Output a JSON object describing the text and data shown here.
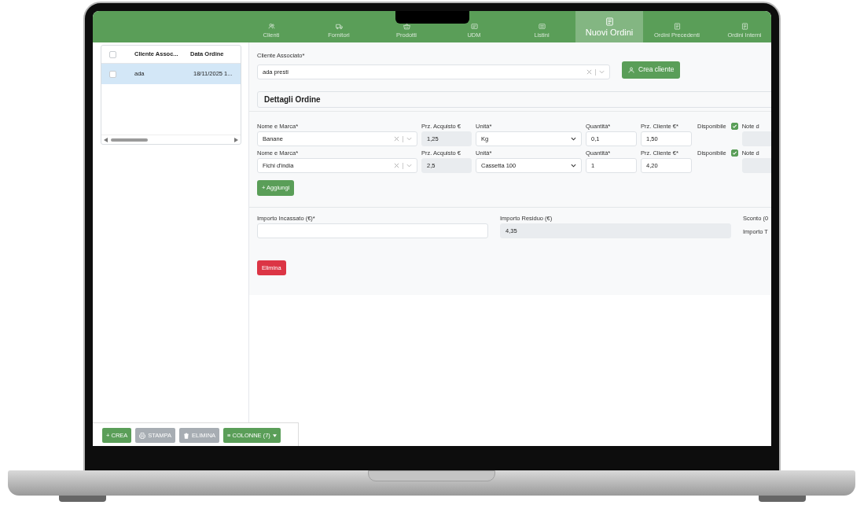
{
  "nav_tabs": [
    {
      "label": "Clienti",
      "selected": false
    },
    {
      "label": "Fornitori",
      "selected": false
    },
    {
      "label": "Prodotti",
      "selected": false
    },
    {
      "label": "UDM",
      "selected": false
    },
    {
      "label": "Listini",
      "selected": false
    },
    {
      "label": "Nuovi Ordini",
      "selected": true
    },
    {
      "label": "Ordini Precedenti",
      "selected": false
    },
    {
      "label": "Ordini Interni",
      "selected": false
    }
  ],
  "orders_grid": {
    "header_checked": false,
    "columns": [
      "Cliente Assoc...",
      "Data Ordine"
    ],
    "rows": [
      {
        "cells": [
          "ada",
          "18/11/2025 1..."
        ],
        "selected": true,
        "checked": false
      }
    ]
  },
  "toolbar": [
    {
      "label": "+ CREA",
      "disabled": false
    },
    {
      "label": "STAMPA",
      "disabled": true
    },
    {
      "label": "ELIMINA",
      "disabled": true
    },
    {
      "label": "≡ COLONNE (7)",
      "disabled": false
    }
  ],
  "customer": {
    "label": "Cliente Associato*",
    "value": "ada presti",
    "create_button": "Crea cliente"
  },
  "section_title": "Dettagli Ordine",
  "items": [
    {
      "name_label": "Nome e Marca*",
      "name_value": "Banane",
      "purchase_label": "Prz. Acquisto €",
      "purchase_value": "1,25",
      "unit_label": "Unità*",
      "unit_value": "Kg",
      "qty_label": "Quantità*",
      "qty_value": "0,1",
      "price_label": "Prz. Cliente €*",
      "price_value": "1,50",
      "available_label": "Disponibile",
      "available": true,
      "notes_label": "Note d"
    },
    {
      "name_label": "Nome e Marca*",
      "name_value": "Fichi d'india",
      "purchase_label": "Prz. Acquisto €",
      "purchase_value": "2,5",
      "unit_label": "Unità*",
      "unit_value": "Cassetta 100",
      "qty_label": "Quantità*",
      "qty_value": "1",
      "price_label": "Prz. Cliente €*",
      "price_value": "4,20",
      "available_label": "Disponibile",
      "available": true,
      "notes_label": "Note d"
    }
  ],
  "add_button": "+ Aggiungi",
  "payment": {
    "collected_label": "Importo Incassato (€)*",
    "residual_label": "Importo Residuo (€)",
    "residual_value": "4,35",
    "discount_label": "Sconto (0",
    "total_label": "Importo T"
  },
  "delete_button": "Elimina"
}
